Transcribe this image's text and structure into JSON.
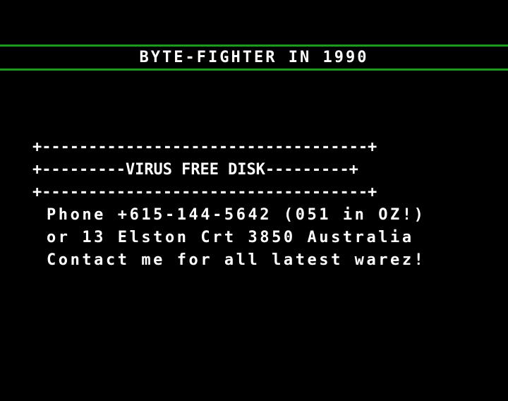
{
  "colors": {
    "background": "#000000",
    "text": "#ffffff",
    "rule": "#1f9a1f"
  },
  "header": {
    "title": "BYTE-FIGHTER IN 1990"
  },
  "box": {
    "border_top": "+-----------------------------------+",
    "label_line": "+---------VIRUS FREE DISK---------+",
    "border_bottom": "+-----------------------------------+"
  },
  "message": {
    "line1": "Phone +615-144-5642 (051 in OZ!)",
    "line2": "or 13 Elston Crt 3850 Australia",
    "line3": "Contact me for all latest warez!"
  }
}
